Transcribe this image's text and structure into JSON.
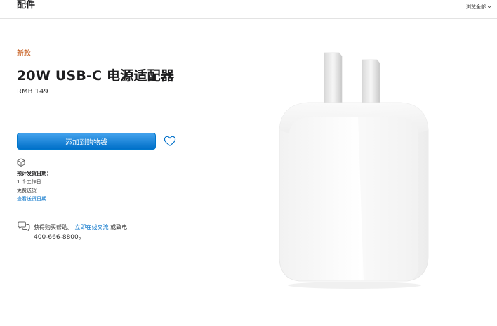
{
  "header": {
    "title": "配件",
    "browse_label": "浏览全部"
  },
  "product": {
    "badge": "新款",
    "title": "20W USB-C 电源适配器",
    "price": "RMB 149",
    "add_to_bag_label": "添加到购物袋"
  },
  "shipping": {
    "heading": "预计发货日期：",
    "lines": [
      "1 个工作日",
      "免费送货"
    ],
    "link": "查看送货日期"
  },
  "help": {
    "prefix": "获得购买帮助。",
    "link": "立即在线交流",
    "suffix": "或致电",
    "phone": "400-666-8800。"
  },
  "colors": {
    "accent": "#0070c9",
    "badge": "#bf4800"
  },
  "icons": [
    "chevron-down-icon",
    "heart-icon",
    "package-icon",
    "chat-icon"
  ]
}
